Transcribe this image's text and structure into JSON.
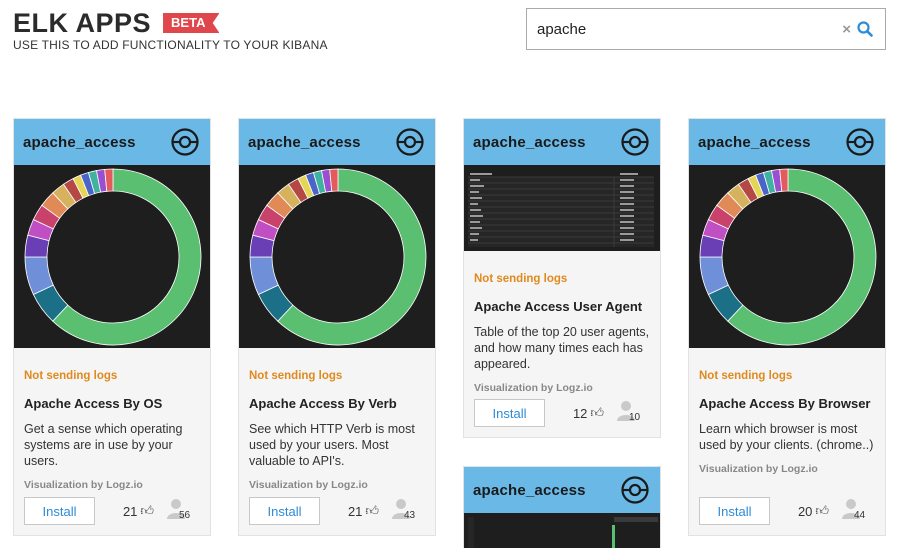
{
  "header": {
    "title": "ELK APPS",
    "badge": "BETA",
    "subtitle": "USE THIS TO ADD FUNCTIONALITY TO YOUR KIBANA"
  },
  "search": {
    "value": "apache",
    "clear_icon": "×"
  },
  "colors": {
    "accent": "#69b8e6",
    "status": "#e08a1e",
    "badge": "#e0474c",
    "link": "#2e8bd6"
  },
  "cards": [
    {
      "name": "apache_access",
      "status": "Not sending logs",
      "title": "Apache Access By OS",
      "description": "Get a sense which operating systems are in use by your users.",
      "by": "Visualization by Logz.io",
      "install_label": "Install",
      "likes": "21",
      "users": "56"
    },
    {
      "name": "apache_access",
      "status": "Not sending logs",
      "title": "Apache Access By Verb",
      "description": "See which HTTP Verb is most used by your users. Most valuable to API's.",
      "by": "Visualization by Logz.io",
      "install_label": "Install",
      "likes": "21",
      "users": "43"
    },
    {
      "name": "apache_access",
      "status": "Not sending logs",
      "title": "Apache Access User Agent",
      "description": "Table of the top 20 user agents, and how many times each has appeared.",
      "by": "Visualization by Logz.io",
      "install_label": "Install",
      "likes": "12",
      "users": "10"
    },
    {
      "name": "apache_access",
      "status": "Not sending logs",
      "title": "Apache Access By Browser",
      "description": "Learn which browser is most used by your clients. (chrome..)",
      "by": "Visualization by Logz.io",
      "install_label": "Install",
      "likes": "20",
      "users": "44"
    },
    {
      "name": "apache_access"
    }
  ],
  "donut_slices": [
    {
      "value": 62,
      "color": "#5bbf72"
    },
    {
      "value": 6,
      "color": "#1b6f86"
    },
    {
      "value": 7,
      "color": "#6f8fd8"
    },
    {
      "value": 4,
      "color": "#6a3fb5"
    },
    {
      "value": 3,
      "color": "#c04fc3"
    },
    {
      "value": 3,
      "color": "#c8426b"
    },
    {
      "value": 3,
      "color": "#e08a57"
    },
    {
      "value": 2.5,
      "color": "#d7b25e"
    },
    {
      "value": 2,
      "color": "#b54845"
    },
    {
      "value": 1.5,
      "color": "#e6d457"
    },
    {
      "value": 1.5,
      "color": "#4a64c8"
    },
    {
      "value": 1.5,
      "color": "#3fb3a0"
    },
    {
      "value": 1.5,
      "color": "#9a4fd0"
    },
    {
      "value": 1.5,
      "color": "#e55b5b"
    }
  ]
}
